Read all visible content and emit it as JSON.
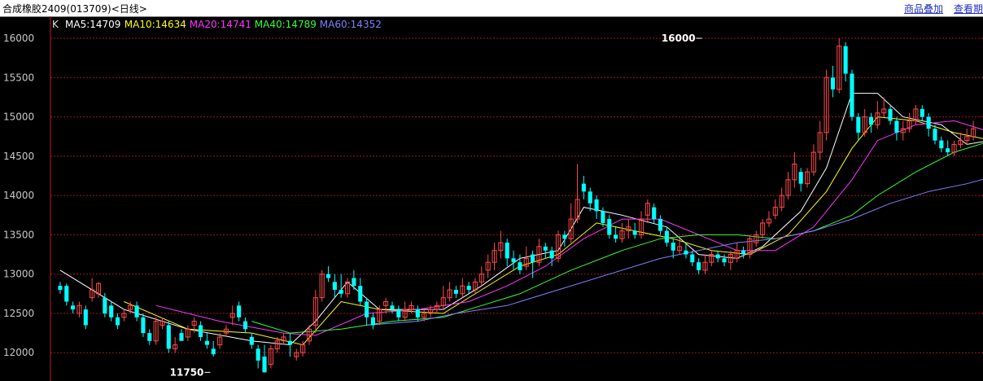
{
  "header": {
    "title": "合成橡胶2409(013709)<日线>",
    "link_overlay": "商品叠加",
    "link_view_period": "查看期"
  },
  "indicator_bar": {
    "k_label": "K",
    "items": [
      {
        "text": "MA5:14709",
        "color": "#ffffff"
      },
      {
        "text": "MA10:14634",
        "color": "#ffff00"
      },
      {
        "text": "MA20:14741",
        "color": "#ff33ff"
      },
      {
        "text": "MA40:14789",
        "color": "#33ff33"
      },
      {
        "text": "MA60:14352",
        "color": "#8080ff"
      }
    ]
  },
  "colors": {
    "background": "#000000",
    "grid": "#a01818",
    "axis": "#b02020",
    "tick_text": "#c8c8c8",
    "up_candle": "#ff4a4a",
    "down_candle": "#00ffff",
    "annotation": "#ffffff"
  },
  "chart_data": {
    "type": "candlestick",
    "yticks": [
      12000,
      12500,
      13000,
      13500,
      14000,
      14500,
      15000,
      15500,
      16000
    ],
    "ylim": [
      11640,
      16280
    ],
    "grid": true,
    "annotations": [
      {
        "text": "16000",
        "x": 100,
        "y": 16000
      },
      {
        "text": "11750",
        "x": 23,
        "y": 11750
      }
    ],
    "candles": [
      [
        12850,
        12800,
        12900,
        12750
      ],
      [
        12850,
        12650,
        12880,
        12600
      ],
      [
        12600,
        12550,
        12650,
        12500
      ],
      [
        12500,
        12600,
        12650,
        12450
      ],
      [
        12550,
        12350,
        12600,
        12300
      ],
      [
        12700,
        12800,
        12950,
        12650
      ],
      [
        12750,
        12880,
        12900,
        12700
      ],
      [
        12700,
        12500,
        12760,
        12450
      ],
      [
        12600,
        12450,
        12650,
        12400
      ],
      [
        12450,
        12350,
        12500,
        12300
      ],
      [
        12450,
        12500,
        12550,
        12400
      ],
      [
        12550,
        12600,
        12650,
        12500
      ],
      [
        12600,
        12450,
        12650,
        12400
      ],
      [
        12450,
        12250,
        12500,
        12200
      ],
      [
        12250,
        12150,
        12300,
        12100
      ],
      [
        12150,
        12400,
        12450,
        12100
      ],
      [
        12350,
        12400,
        12450,
        12300
      ],
      [
        12350,
        12050,
        12400,
        12000
      ],
      [
        12050,
        12100,
        12200,
        12000
      ],
      [
        12250,
        12150,
        12300,
        12150
      ],
      [
        12200,
        12300,
        12350,
        12150
      ],
      [
        12350,
        12400,
        12450,
        12250
      ],
      [
        12350,
        12200,
        12400,
        12150
      ],
      [
        12150,
        12100,
        12250,
        12050
      ],
      [
        12050,
        11980,
        12150,
        11950
      ],
      [
        12100,
        12200,
        12250,
        12050
      ],
      [
        12250,
        12300,
        12350,
        12200
      ],
      [
        12450,
        12500,
        12600,
        12350
      ],
      [
        12600,
        12450,
        12650,
        12400
      ],
      [
        12400,
        12300,
        12450,
        12250
      ],
      [
        12200,
        12100,
        12250,
        12050
      ],
      [
        12050,
        11900,
        12100,
        11800
      ],
      [
        11950,
        11750,
        12100,
        11750
      ],
      [
        11850,
        12050,
        12100,
        11800
      ],
      [
        12050,
        12150,
        12200,
        12000
      ],
      [
        12150,
        12200,
        12250,
        12100
      ],
      [
        12150,
        12100,
        12250,
        11950
      ],
      [
        11950,
        12000,
        12050,
        11900
      ],
      [
        12000,
        12100,
        12150,
        11950
      ],
      [
        12150,
        12300,
        12350,
        12100
      ],
      [
        12350,
        12700,
        12800,
        12250
      ],
      [
        12700,
        13000,
        13050,
        12650
      ],
      [
        13000,
        12950,
        13100,
        12900
      ],
      [
        12900,
        12800,
        13000,
        12700
      ],
      [
        12800,
        12750,
        13000,
        12700
      ],
      [
        12750,
        12900,
        12950,
        12700
      ],
      [
        12950,
        12850,
        13050,
        12800
      ],
      [
        12850,
        12650,
        12950,
        12600
      ],
      [
        12650,
        12450,
        12700,
        12350
      ],
      [
        12450,
        12350,
        12500,
        12300
      ],
      [
        12400,
        12550,
        12600,
        12350
      ],
      [
        12600,
        12650,
        12700,
        12500
      ],
      [
        12600,
        12550,
        12650,
        12500
      ],
      [
        12550,
        12450,
        12600,
        12400
      ],
      [
        12450,
        12550,
        12650,
        12400
      ],
      [
        12550,
        12600,
        12650,
        12500
      ],
      [
        12550,
        12450,
        12600,
        12400
      ],
      [
        12450,
        12500,
        12550,
        12400
      ],
      [
        12500,
        12550,
        12600,
        12450
      ],
      [
        12550,
        12600,
        12650,
        12500
      ],
      [
        12600,
        12700,
        12850,
        12550
      ],
      [
        12700,
        12800,
        12900,
        12650
      ],
      [
        12800,
        12750,
        12850,
        12700
      ],
      [
        12750,
        12850,
        12950,
        12700
      ],
      [
        12850,
        12800,
        12900,
        12750
      ],
      [
        12800,
        12900,
        12950,
        12750
      ],
      [
        12900,
        13000,
        13100,
        12850
      ],
      [
        13050,
        13150,
        13250,
        12950
      ],
      [
        13150,
        13300,
        13400,
        13050
      ],
      [
        13300,
        13400,
        13550,
        13200
      ],
      [
        13400,
        13200,
        13450,
        13100
      ],
      [
        13200,
        13150,
        13300,
        13050
      ],
      [
        13150,
        13050,
        13250,
        13000
      ],
      [
        13100,
        13200,
        13350,
        13050
      ],
      [
        13250,
        13150,
        13300,
        12950
      ],
      [
        13150,
        13350,
        13450,
        13100
      ],
      [
        13350,
        13300,
        13400,
        13200
      ],
      [
        13300,
        13200,
        13350,
        13100
      ],
      [
        13200,
        13500,
        13550,
        13150
      ],
      [
        13500,
        13450,
        13550,
        13350
      ],
      [
        13450,
        13700,
        13900,
        13400
      ],
      [
        13700,
        13950,
        14400,
        13650
      ],
      [
        14150,
        14050,
        14250,
        13950
      ],
      [
        14050,
        13900,
        14100,
        13800
      ],
      [
        13950,
        13800,
        14000,
        13700
      ],
      [
        13800,
        13650,
        13850,
        13600
      ],
      [
        13700,
        13500,
        13750,
        13450
      ],
      [
        13500,
        13450,
        13600,
        13400
      ],
      [
        13450,
        13550,
        13650,
        13400
      ],
      [
        13550,
        13600,
        13700,
        13450
      ],
      [
        13550,
        13500,
        13650,
        13450
      ],
      [
        13500,
        13700,
        13800,
        13450
      ],
      [
        13750,
        13900,
        13950,
        13650
      ],
      [
        13850,
        13700,
        13900,
        13650
      ],
      [
        13700,
        13550,
        13750,
        13500
      ],
      [
        13550,
        13400,
        13600,
        13350
      ],
      [
        13400,
        13300,
        13450,
        13200
      ],
      [
        13300,
        13350,
        13450,
        13250
      ],
      [
        13300,
        13250,
        13400,
        13200
      ],
      [
        13250,
        13150,
        13300,
        13100
      ],
      [
        13150,
        13050,
        13200,
        13000
      ],
      [
        13050,
        13150,
        13250,
        13000
      ],
      [
        13150,
        13250,
        13300,
        13100
      ],
      [
        13250,
        13200,
        13300,
        13150
      ],
      [
        13200,
        13150,
        13250,
        13100
      ],
      [
        13150,
        13250,
        13300,
        13050
      ],
      [
        13200,
        13300,
        13400,
        13150
      ],
      [
        13300,
        13250,
        13350,
        13200
      ],
      [
        13250,
        13450,
        13500,
        13200
      ],
      [
        13400,
        13500,
        13550,
        13350
      ],
      [
        13500,
        13650,
        13700,
        13450
      ],
      [
        13650,
        13700,
        13800,
        13600
      ],
      [
        13750,
        13850,
        13950,
        13700
      ],
      [
        13850,
        14000,
        14100,
        13800
      ],
      [
        14000,
        14200,
        14300,
        13950
      ],
      [
        14200,
        14400,
        14550,
        14100
      ],
      [
        14300,
        14150,
        14350,
        14050
      ],
      [
        14150,
        14300,
        14350,
        14100
      ],
      [
        14300,
        14550,
        14650,
        14250
      ],
      [
        14550,
        14800,
        14950,
        14450
      ],
      [
        14800,
        15500,
        15600,
        14700
      ],
      [
        15500,
        15350,
        15650,
        15250
      ],
      [
        15350,
        15900,
        16000,
        15300
      ],
      [
        15900,
        15550,
        15950,
        15450
      ],
      [
        15550,
        15000,
        15600,
        14950
      ],
      [
        15000,
        14800,
        15050,
        14700
      ],
      [
        14800,
        15000,
        15100,
        14750
      ],
      [
        15000,
        14900,
        15050,
        14800
      ],
      [
        14900,
        15050,
        15200,
        14850
      ],
      [
        15050,
        15100,
        15250,
        15000
      ],
      [
        15100,
        14950,
        15150,
        14900
      ],
      [
        14950,
        14800,
        15000,
        14700
      ],
      [
        14800,
        14850,
        14950,
        14700
      ],
      [
        14850,
        14950,
        15050,
        14800
      ],
      [
        14950,
        15100,
        15150,
        14900
      ],
      [
        15100,
        15000,
        15150,
        14950
      ],
      [
        15000,
        14850,
        15050,
        14750
      ],
      [
        14850,
        14700,
        14900,
        14650
      ],
      [
        14700,
        14600,
        14750,
        14550
      ],
      [
        14600,
        14550,
        14700,
        14500
      ],
      [
        14550,
        14650,
        14700,
        14500
      ],
      [
        14650,
        14700,
        14800,
        14600
      ],
      [
        14700,
        14750,
        14850,
        14650
      ],
      [
        14750,
        14850,
        14950,
        14700
      ]
    ],
    "ma": {
      "MA5": [
        [
          0,
          13050
        ],
        [
          10,
          12550
        ],
        [
          20,
          12300
        ],
        [
          30,
          12150
        ],
        [
          36,
          12100
        ],
        [
          40,
          12400
        ],
        [
          45,
          12900
        ],
        [
          50,
          12550
        ],
        [
          60,
          12550
        ],
        [
          66,
          12850
        ],
        [
          72,
          13200
        ],
        [
          78,
          13300
        ],
        [
          82,
          13850
        ],
        [
          88,
          13750
        ],
        [
          95,
          13600
        ],
        [
          100,
          13250
        ],
        [
          106,
          13200
        ],
        [
          110,
          13350
        ],
        [
          116,
          13800
        ],
        [
          120,
          14350
        ],
        [
          124,
          15300
        ],
        [
          128,
          15300
        ],
        [
          132,
          15000
        ],
        [
          138,
          14900
        ],
        [
          142,
          14650
        ],
        [
          147,
          14720
        ],
        [
          151,
          14709
        ]
      ],
      "MA10": [
        [
          10,
          12650
        ],
        [
          20,
          12300
        ],
        [
          30,
          12250
        ],
        [
          38,
          12100
        ],
        [
          44,
          12650
        ],
        [
          50,
          12550
        ],
        [
          60,
          12500
        ],
        [
          66,
          12800
        ],
        [
          72,
          13100
        ],
        [
          78,
          13250
        ],
        [
          84,
          13650
        ],
        [
          90,
          13550
        ],
        [
          96,
          13450
        ],
        [
          102,
          13300
        ],
        [
          108,
          13250
        ],
        [
          114,
          13500
        ],
        [
          120,
          14050
        ],
        [
          124,
          14600
        ],
        [
          128,
          15000
        ],
        [
          134,
          14950
        ],
        [
          140,
          14800
        ],
        [
          146,
          14700
        ],
        [
          151,
          14634
        ]
      ],
      "MA20": [
        [
          15,
          12600
        ],
        [
          25,
          12400
        ],
        [
          35,
          12250
        ],
        [
          40,
          12220
        ],
        [
          48,
          12500
        ],
        [
          56,
          12550
        ],
        [
          64,
          12650
        ],
        [
          70,
          12850
        ],
        [
          76,
          13100
        ],
        [
          82,
          13450
        ],
        [
          88,
          13700
        ],
        [
          94,
          13700
        ],
        [
          100,
          13500
        ],
        [
          106,
          13300
        ],
        [
          112,
          13300
        ],
        [
          118,
          13600
        ],
        [
          124,
          14200
        ],
        [
          128,
          14700
        ],
        [
          134,
          14900
        ],
        [
          140,
          14950
        ],
        [
          146,
          14800
        ],
        [
          151,
          14741
        ]
      ],
      "MA40": [
        [
          30,
          12400
        ],
        [
          36,
          12250
        ],
        [
          44,
          12300
        ],
        [
          52,
          12400
        ],
        [
          60,
          12450
        ],
        [
          66,
          12600
        ],
        [
          72,
          12750
        ],
        [
          80,
          13050
        ],
        [
          88,
          13300
        ],
        [
          94,
          13450
        ],
        [
          100,
          13500
        ],
        [
          106,
          13500
        ],
        [
          112,
          13450
        ],
        [
          118,
          13550
        ],
        [
          124,
          13750
        ],
        [
          128,
          14000
        ],
        [
          134,
          14300
        ],
        [
          140,
          14550
        ],
        [
          146,
          14700
        ],
        [
          151,
          14789
        ]
      ],
      "MA60": [
        [
          48,
          12350
        ],
        [
          56,
          12400
        ],
        [
          62,
          12500
        ],
        [
          70,
          12600
        ],
        [
          78,
          12800
        ],
        [
          86,
          13000
        ],
        [
          94,
          13200
        ],
        [
          100,
          13300
        ],
        [
          106,
          13400
        ],
        [
          112,
          13450
        ],
        [
          118,
          13550
        ],
        [
          124,
          13700
        ],
        [
          130,
          13900
        ],
        [
          136,
          14050
        ],
        [
          142,
          14150
        ],
        [
          151,
          14352
        ]
      ]
    }
  }
}
